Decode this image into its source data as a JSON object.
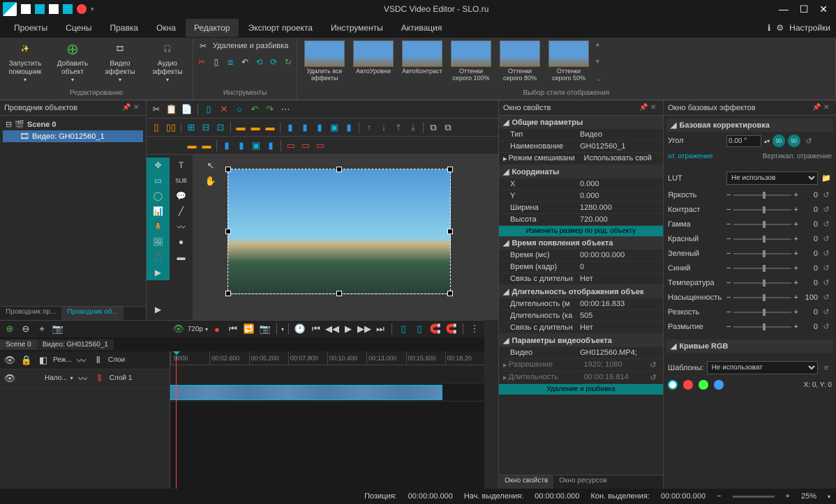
{
  "title": "VSDC Video Editor - SLO.ru",
  "menu": [
    "Проекты",
    "Сцены",
    "Правка",
    "Окна",
    "Редактор",
    "Экспорт проекта",
    "Инструменты",
    "Активация"
  ],
  "menu_active": 4,
  "settings_label": "Настройки",
  "ribbon": {
    "wizard": "Запустить помощник",
    "add_object": "Добавить объект",
    "video_fx": "Видео эффекты",
    "audio_fx": "Аудио эффекты",
    "group1_title": "Редактирование",
    "del_split": "Удаление и разбивка",
    "group2_title": "Инструменты",
    "thumbs": [
      {
        "label": "Удалить все эффекты"
      },
      {
        "label": "АвтоУровни"
      },
      {
        "label": "АвтоКонтраст"
      },
      {
        "label": "Оттенки серого 100%"
      },
      {
        "label": "Оттенки серого 80%"
      },
      {
        "label": "Оттенки серого 50%"
      }
    ],
    "group3_title": "Выбор стиля отображения"
  },
  "explorer": {
    "title": "Проводник объектов",
    "scene": "Scene 0",
    "video": "Видео: GH012560_1",
    "tabs": [
      "Проводник пр...",
      "Проводник об..."
    ]
  },
  "props": {
    "title": "Окно свойств",
    "sections": {
      "general": "Общие параметры",
      "coords": "Координаты",
      "appear": "Время появления объекта",
      "duration": "Длительность отображения объек",
      "videoobj": "Параметры видеообъекта"
    },
    "rows": {
      "type_k": "Тип",
      "type_v": "Видео",
      "name_k": "Наименование",
      "name_v": "GH012560_1",
      "blend_k": "Режим смешивани",
      "blend_v": "Использовать свой",
      "x_k": "X",
      "x_v": "0.000",
      "y_k": "Y",
      "y_v": "0.000",
      "w_k": "Ширина",
      "w_v": "1280.000",
      "h_k": "Высота",
      "h_v": "720.000",
      "resize_action": "Изменить размер по род. объекту",
      "time_ms_k": "Время (мс)",
      "time_ms_v": "00:00:00.000",
      "time_f_k": "Время (кадр)",
      "time_f_v": "0",
      "link1_k": "Связь с длительн",
      "link1_v": "Нет",
      "dur_ms_k": "Длительность (м",
      "dur_ms_v": "00:00:16.833",
      "dur_f_k": "Длительность (ка",
      "dur_f_v": "505",
      "link2_k": "Связь с длительн",
      "link2_v": "Нет",
      "video_k": "Видео",
      "video_v": "GH012560.MP4;",
      "res_k": "Разрешение",
      "res_v": "1920; 1080",
      "vdur_k": "Длительность",
      "vdur_v": "00:00:16.814",
      "split_action": "Удаление и разбивка"
    },
    "bottom_tabs": [
      "Окно свойств",
      "Окно ресурсов"
    ]
  },
  "fx": {
    "title": "Окно базовых эффектов",
    "section1": "Базовая корректировка",
    "angle_k": "Угол",
    "angle_v": "0.00 °",
    "hflip": "нт. отражение",
    "vflip": "Вертикал. отражение",
    "lut_k": "LUT",
    "lut_v": "Не использов",
    "sliders": [
      {
        "k": "Яркость",
        "v": "0"
      },
      {
        "k": "Контраст",
        "v": "0"
      },
      {
        "k": "Гамма",
        "v": "0"
      },
      {
        "k": "Красный",
        "v": "0"
      },
      {
        "k": "Зеленый",
        "v": "0"
      },
      {
        "k": "Синий",
        "v": "0"
      },
      {
        "k": "Температура",
        "v": "0"
      },
      {
        "k": "Насыщенность",
        "v": "100"
      },
      {
        "k": "Резкость",
        "v": "0"
      },
      {
        "k": "Размытие",
        "v": "0"
      }
    ],
    "section2": "Кривые RGB",
    "templates_k": "Шаблоны:",
    "templates_v": "Не использоват",
    "coords": "X: 0, Y: 0"
  },
  "timeline": {
    "res_label": "720p",
    "scene_tab": "Scene 0",
    "video_tab": "Видео: GH012560_1",
    "ruler": [
      ":0000",
      "00:02.600",
      "00:05.200",
      "00:07.800",
      "00:10.400",
      "00:13.000",
      "00:15.600",
      "00:18.20"
    ],
    "mode_col": "Реж...",
    "layers_col": "Слои",
    "mode_val": "Нало...",
    "layer_val": "Слой 1"
  },
  "status": {
    "pos_k": "Позиция:",
    "pos_v": "00:00:00.000",
    "sel_start_k": "Нач. выделения:",
    "sel_start_v": "00:00:00.000",
    "sel_end_k": "Кон. выделения:",
    "sel_end_v": "00:00:00.000",
    "zoom": "25%"
  }
}
